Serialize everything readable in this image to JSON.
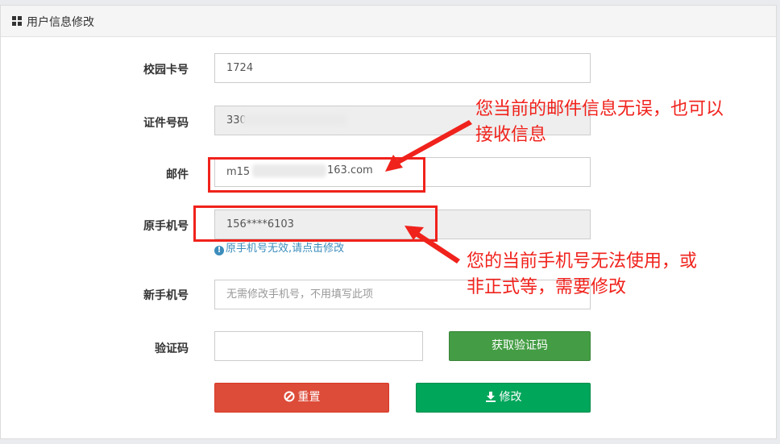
{
  "panel": {
    "title": "用户信息修改",
    "icon": "grid-icon"
  },
  "form": {
    "campus_card": {
      "label": "校园卡号",
      "value": "1724"
    },
    "id_number": {
      "label": "证件号码",
      "value": "330"
    },
    "email": {
      "label": "邮件",
      "value": "m15",
      "value_suffix": "163.com"
    },
    "old_phone": {
      "label": "原手机号",
      "value": "156****6103",
      "hint": "原手机号无效,请点击修改"
    },
    "new_phone": {
      "label": "新手机号",
      "placeholder": "无需修改手机号，不用填写此项"
    },
    "verify_code": {
      "label": "验证码",
      "value": "",
      "button": "获取验证码"
    },
    "reset_button": "重置",
    "submit_button": "修改"
  },
  "annotations": {
    "email_note": [
      "您当前的邮件信息无误，也可以",
      "接收信息"
    ],
    "phone_note": [
      "您的当前手机号无法使用，或",
      "非正式等，需要修改"
    ],
    "color": "#f0221c"
  },
  "colors": {
    "reset": "#dd4b39",
    "submit": "#00a65a",
    "code": "#449d44",
    "link": "#3c8dbc"
  }
}
